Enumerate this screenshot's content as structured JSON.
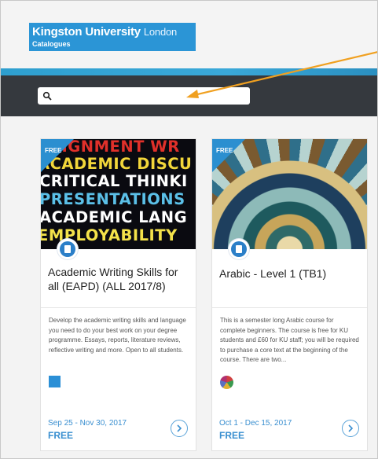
{
  "header": {
    "brand_name": "Kingston University",
    "brand_city": "London",
    "brand_sub": "Catalogues"
  },
  "search": {
    "value": "",
    "placeholder": ""
  },
  "colors": {
    "brand": "#2b95d6",
    "nav": "#35393e",
    "accent": "#3a8fd0"
  },
  "courses": [
    {
      "tag": "FREE",
      "image_lines": [
        "SIGNMENT WR",
        "ACADEMIC DISCU",
        "CRITICAL THINKI",
        "PRESENTATIONS",
        "ACADEMIC LANG",
        "EMPLOYABILITY"
      ],
      "title": "Academic Writing Skills for all (EAPD) (ALL 2017/8)",
      "description": "Develop the academic writing skills and language you need to do your best work on your degree programme. Essays, reports, literature reviews, reflective writing and more. Open to all students.",
      "provider_icon": "kingston-logo",
      "dates": "Sep 25 - Nov 30, 2017",
      "price": "FREE"
    },
    {
      "tag": "FREE",
      "image_icon": "islamic-mosaic-image",
      "title": "Arabic - Level 1 (TB1)",
      "description": "This is a semester long Arabic course for complete beginners. The course is free for KU students and £60 for KU staff; you will be required to purchase a core text at the beginning of the course. There are two...",
      "provider_icon": "round-provider-avatar",
      "dates": "Oct 1 - Dec 15, 2017",
      "price": "FREE"
    }
  ]
}
